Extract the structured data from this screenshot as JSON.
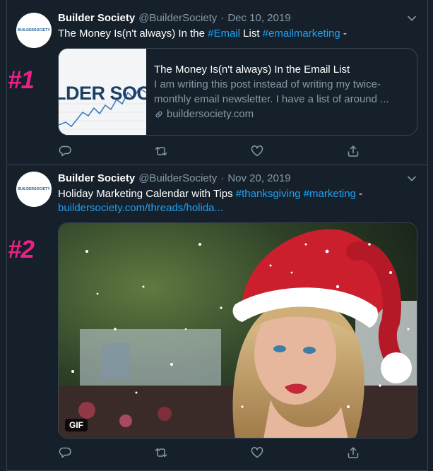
{
  "markers": [
    "#1",
    "#2"
  ],
  "tweets": [
    {
      "avatar_text": "BUILDERSOCIETY",
      "name": "Builder Society",
      "handle": "@BuilderSociety",
      "separator": "·",
      "date": "Dec 10, 2019",
      "text": {
        "part1": "The Money Is(n't always) In the ",
        "hashtag1": "#Email",
        "part2": " List ",
        "hashtag2": "#emailmarketing",
        "part3": " -"
      },
      "card": {
        "thumb_text": "LDER SOCI",
        "title": "The Money Is(n't always) In the Email List",
        "description": "I am writing this post instead of writing my twice-monthly email newsletter. I have a list of around ...",
        "domain": "buildersociety.com"
      },
      "icons": [
        "reply-icon",
        "retweet-icon",
        "like-icon",
        "share-icon"
      ]
    },
    {
      "avatar_text": "BUILDERSOCIETY",
      "name": "Builder Society",
      "handle": "@BuilderSociety",
      "separator": "·",
      "date": "Nov 20, 2019",
      "text": {
        "part1": "Holiday Marketing Calendar with Tips ",
        "hashtag1": "#thanksgiving",
        "part2": " ",
        "hashtag2": "#marketing",
        "part3": " -",
        "url": "buildersociety.com/threads/holida..."
      },
      "media": {
        "badge": "GIF"
      },
      "icons": [
        "reply-icon",
        "retweet-icon",
        "like-icon",
        "share-icon"
      ]
    }
  ],
  "colors": {
    "background": "#15202b",
    "border": "#38444d",
    "secondary_text": "#8899a6",
    "link": "#1da1f2",
    "marker": "#ee1f87"
  }
}
